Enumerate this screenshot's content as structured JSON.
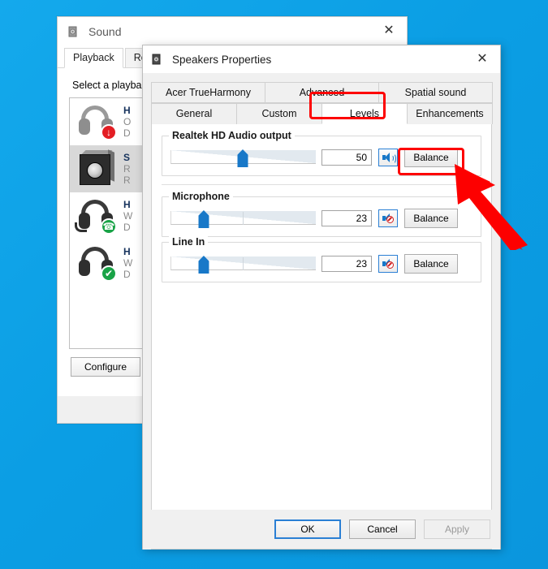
{
  "desktop": {
    "background_color": "#0fa3e8"
  },
  "sound_window": {
    "title": "Sound",
    "icon": "speaker-icon",
    "close_label": "✕",
    "tabs": [
      {
        "label": "Playback",
        "active": true
      },
      {
        "label": "Recor",
        "active": false
      }
    ],
    "prompt": "Select a playba",
    "devices": [
      {
        "icon": "headphones-icon",
        "badge": "red-down-arrow",
        "badge_glyph": "↓",
        "name": "H",
        "sub1": "O",
        "sub2": "D",
        "selected": false
      },
      {
        "icon": "speaker-box-icon",
        "badge": "none",
        "badge_glyph": "",
        "name": "S",
        "sub1": "R",
        "sub2": "R",
        "selected": true
      },
      {
        "icon": "headset-icon",
        "badge": "green-phone",
        "badge_glyph": "☎",
        "name": "H",
        "sub1": "W",
        "sub2": "D",
        "selected": false
      },
      {
        "icon": "headset-icon",
        "badge": "green-check",
        "badge_glyph": "✔",
        "name": "H",
        "sub1": "W",
        "sub2": "D",
        "selected": false
      }
    ],
    "configure_label": "Configure"
  },
  "properties_dialog": {
    "title": "Speakers Properties",
    "icon": "speaker-icon",
    "close_label": "✕",
    "tabs_top": [
      {
        "label": "Acer TrueHarmony",
        "active": false
      },
      {
        "label": "Advanced",
        "active": false
      },
      {
        "label": "Spatial sound",
        "active": false
      }
    ],
    "tabs_bottom": [
      {
        "label": "General",
        "active": false
      },
      {
        "label": "Custom",
        "active": false
      },
      {
        "label": "Levels",
        "active": true
      },
      {
        "label": "Enhancements",
        "active": false
      }
    ],
    "levels": [
      {
        "label": "Realtek HD Audio output",
        "value": "50",
        "slider_percent": 50,
        "muted": false,
        "mute_icon": "speaker-on-icon",
        "balance_label": "Balance"
      },
      {
        "label": "Microphone",
        "value": "23",
        "slider_percent": 23,
        "muted": true,
        "mute_icon": "speaker-muted-icon",
        "balance_label": "Balance"
      },
      {
        "label": "Line In",
        "value": "23",
        "slider_percent": 23,
        "muted": true,
        "mute_icon": "speaker-muted-icon",
        "balance_label": "Balance"
      }
    ],
    "buttons": {
      "ok": "OK",
      "cancel": "Cancel",
      "apply": "Apply"
    }
  },
  "annotations": {
    "highlight_color": "#fd0000",
    "boxes": [
      {
        "target": "levels-tab"
      },
      {
        "target": "balance-button"
      }
    ],
    "arrow": {
      "target": "balance-button",
      "direction": "up-left"
    }
  }
}
